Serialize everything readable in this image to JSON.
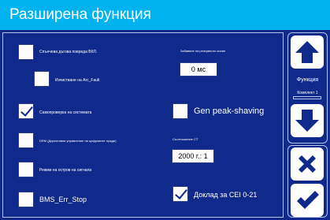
{
  "window": {
    "title": "Разширена функция"
  },
  "options": {
    "spark_detection": {
      "label": "Спънчева дъгова повреда ВКЛ.",
      "checked": false
    },
    "clear_arc_fault": {
      "label": "Изчистване на Arc_Fault",
      "checked": false
    },
    "system_selfcheck": {
      "label": "Самопроверка на системата",
      "checked": true
    },
    "drm": {
      "label": "DRM (Директивни управление на цифровите нужди)",
      "checked": false
    },
    "signal_island": {
      "label": "Режим на остров на сигнала",
      "checked": false
    },
    "bms_err_stop": {
      "label": "BMS_Err_Stop",
      "checked": false
    },
    "gen_peak_shaving": {
      "label": "Gen peak-shaving",
      "checked": false
    },
    "cei_report": {
      "label": "Доклад за CEI 0-21",
      "checked": true
    }
  },
  "fields": {
    "delay": {
      "label": "Забавяне на резервното копие",
      "value": "0 мс"
    },
    "ct_ratio": {
      "label": "Съотношение CT",
      "value": "2000 г.: 1"
    }
  },
  "side": {
    "up_icon": "arrow-up-icon",
    "down_icon": "arrow-down-icon",
    "function_label": "Функция",
    "set_label": "Комплект 1",
    "cancel_icon": "close-icon",
    "confirm_icon": "check-icon"
  },
  "colors": {
    "background": "#0f2a8a",
    "titlebar": "#00b3ee",
    "text": "#ffffff"
  }
}
